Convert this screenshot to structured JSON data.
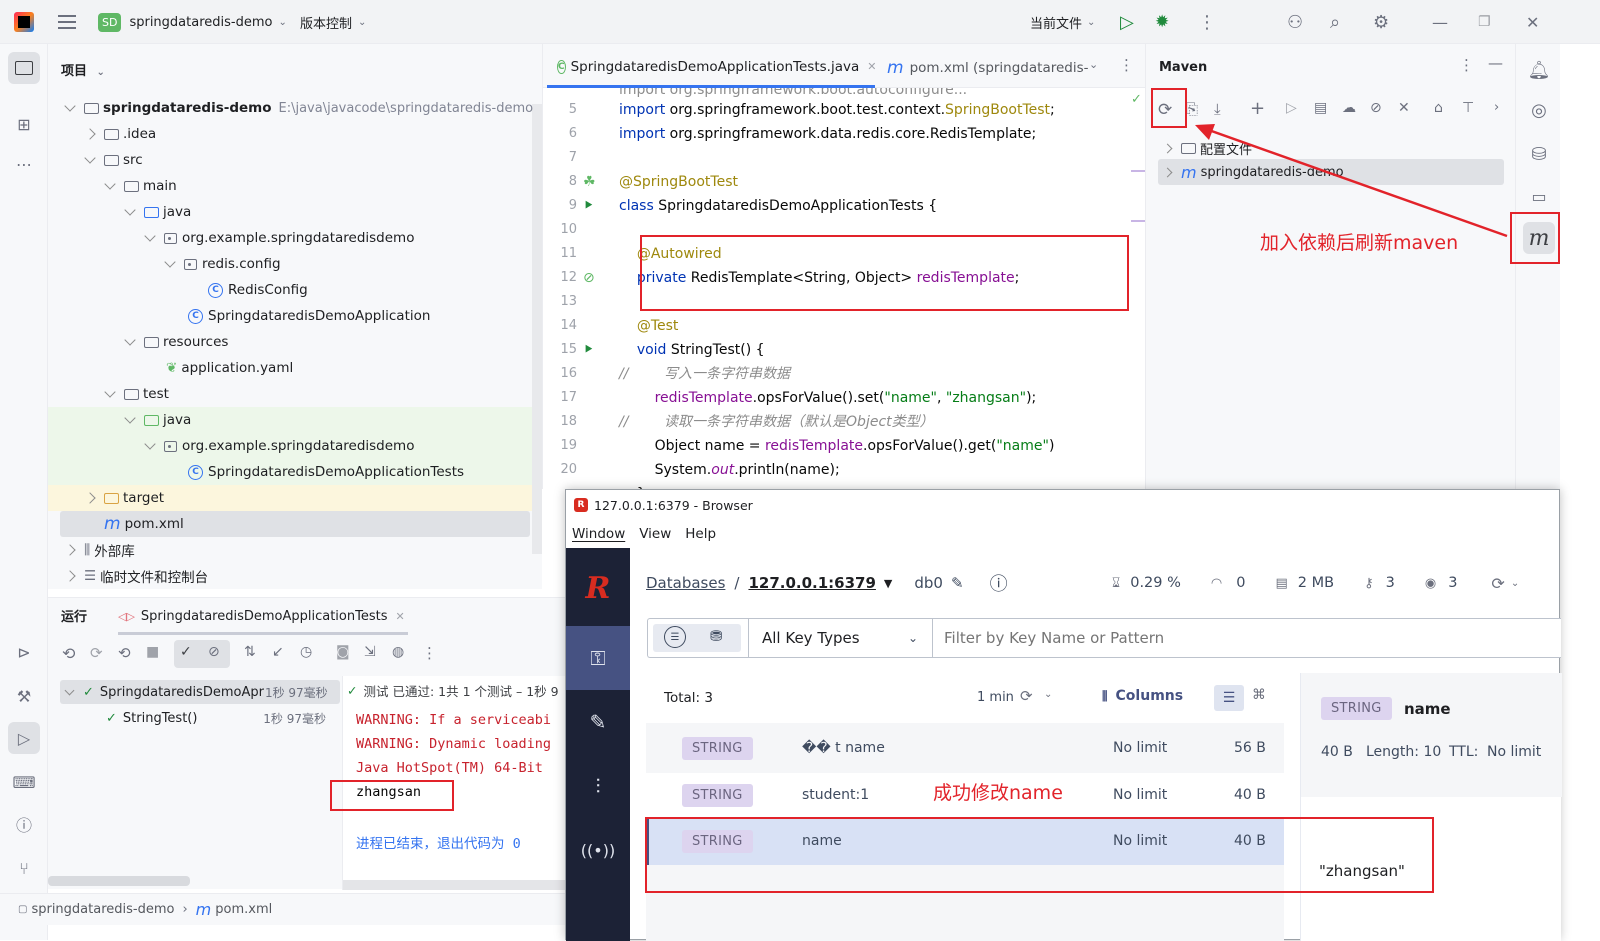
{
  "titlebar": {
    "project_badge": "SD",
    "project_name": "springdataredis-demo",
    "vcs": "版本控制",
    "run_config": "当前文件"
  },
  "project_panel": {
    "title": "项目",
    "items": [
      {
        "label": "springdataredis-demo",
        "path": "E:\\java\\javacode\\springdataredis-demo"
      },
      {
        "label": ".idea"
      },
      {
        "label": "src"
      },
      {
        "label": "main"
      },
      {
        "label": "java"
      },
      {
        "label": "org.example.springdataredisdemo"
      },
      {
        "label": "redis.config"
      },
      {
        "label": "RedisConfig"
      },
      {
        "label": "SpringdataredisDemoApplication"
      },
      {
        "label": "resources"
      },
      {
        "label": "application.yaml"
      },
      {
        "label": "test"
      },
      {
        "label": "java"
      },
      {
        "label": "org.example.springdataredisdemo"
      },
      {
        "label": "SpringdataredisDemoApplicationTests"
      },
      {
        "label": "target"
      },
      {
        "label": "pom.xml"
      },
      {
        "label": "外部库"
      },
      {
        "label": "临时文件和控制台"
      }
    ]
  },
  "editor": {
    "tabs": [
      {
        "label": "SpringdataredisDemoApplicationTests.java"
      },
      {
        "label": "pom.xml (springdataredis-"
      }
    ],
    "lines": [
      {
        "n": "5",
        "text": "import org.springframework.boot.test.context.SpringBootTest;"
      },
      {
        "n": "6",
        "text": "import org.springframework.data.redis.core.RedisTemplate;"
      },
      {
        "n": "7",
        "text": ""
      },
      {
        "n": "8",
        "text": "@SpringBootTest"
      },
      {
        "n": "9",
        "text": "class SpringdataredisDemoApplicationTests {"
      },
      {
        "n": "10",
        "text": ""
      },
      {
        "n": "11",
        "text": "    @Autowired"
      },
      {
        "n": "12",
        "text": "    private RedisTemplate<String, Object> redisTemplate;"
      },
      {
        "n": "13",
        "text": ""
      },
      {
        "n": "14",
        "text": "    @Test"
      },
      {
        "n": "15",
        "text": "    void StringTest() {"
      },
      {
        "n": "16",
        "text": "//        写入一条字符串数据"
      },
      {
        "n": "17",
        "text": "        redisTemplate.opsForValue().set(\"name\", \"zhangsan\");"
      },
      {
        "n": "18",
        "text": "//        读取一条字符串数据（默认是Object类型）"
      },
      {
        "n": "19",
        "text": "        Object name = redisTemplate.opsForValue().get(\"name\")"
      },
      {
        "n": "20",
        "text": "        System.out.println(name);"
      }
    ]
  },
  "maven": {
    "title": "Maven",
    "items": [
      {
        "label": "配置文件"
      },
      {
        "label": "springdataredis-demo"
      }
    ]
  },
  "run_panel": {
    "tab_label": "运行",
    "config_name": "SpringdataredisDemoApplicationTests",
    "status": "测试 已通过: 1共 1 个测试 – 1秒 9",
    "tree": [
      {
        "label": "SpringdataredisDemoApr",
        "time": "1秒 97毫秒"
      },
      {
        "label": "StringTest()",
        "time": "1秒 97毫秒"
      }
    ],
    "console": [
      "WARNING: If a serviceabi",
      "WARNING: Dynamic loading",
      "Java HotSpot(TM) 64-Bit ",
      "zhangsan",
      "",
      "进程已结束，退出代码为 0"
    ]
  },
  "statusbar": {
    "crumbs": [
      "springdataredis-demo",
      "pom.xml"
    ]
  },
  "redis_window": {
    "title": "127.0.0.1:6379 - Browser",
    "menu": [
      "Window",
      "View",
      "Help"
    ],
    "breadcrumb_databases": "Databases",
    "breadcrumb_host": "127.0.0.1:6379",
    "db": "db0",
    "stats": {
      "cpu": "0.29 %",
      "ops": "0",
      "memory": "2 MB",
      "keys": "3",
      "clients": "3"
    },
    "key_type_filter": "All Key Types",
    "filter_placeholder": "Filter by Key Name or Pattern",
    "total": "Total: 3",
    "refresh": "1 min",
    "columns_label": "Columns",
    "rows": [
      {
        "type": "STRING",
        "key": "�� t name",
        "ttl": "No limit",
        "size": "56 B"
      },
      {
        "type": "STRING",
        "key": "student:1",
        "ttl": "No limit",
        "size": "40 B"
      },
      {
        "type": "STRING",
        "key": "name",
        "ttl": "No limit",
        "size": "40 B"
      }
    ],
    "detail": {
      "type": "STRING",
      "key": "name",
      "size": "40 B",
      "length": "Length: 10",
      "ttl_label": "TTL:",
      "ttl_value": "No limit",
      "value": "\"zhangsan\""
    }
  },
  "annotations": {
    "maven_refresh": "加入依赖后刷新maven",
    "modified": "成功修改name"
  },
  "colors": {
    "annotation_red": "#e2232a",
    "redis_sidebar": "#1c2236",
    "redis_accent": "#465282"
  }
}
